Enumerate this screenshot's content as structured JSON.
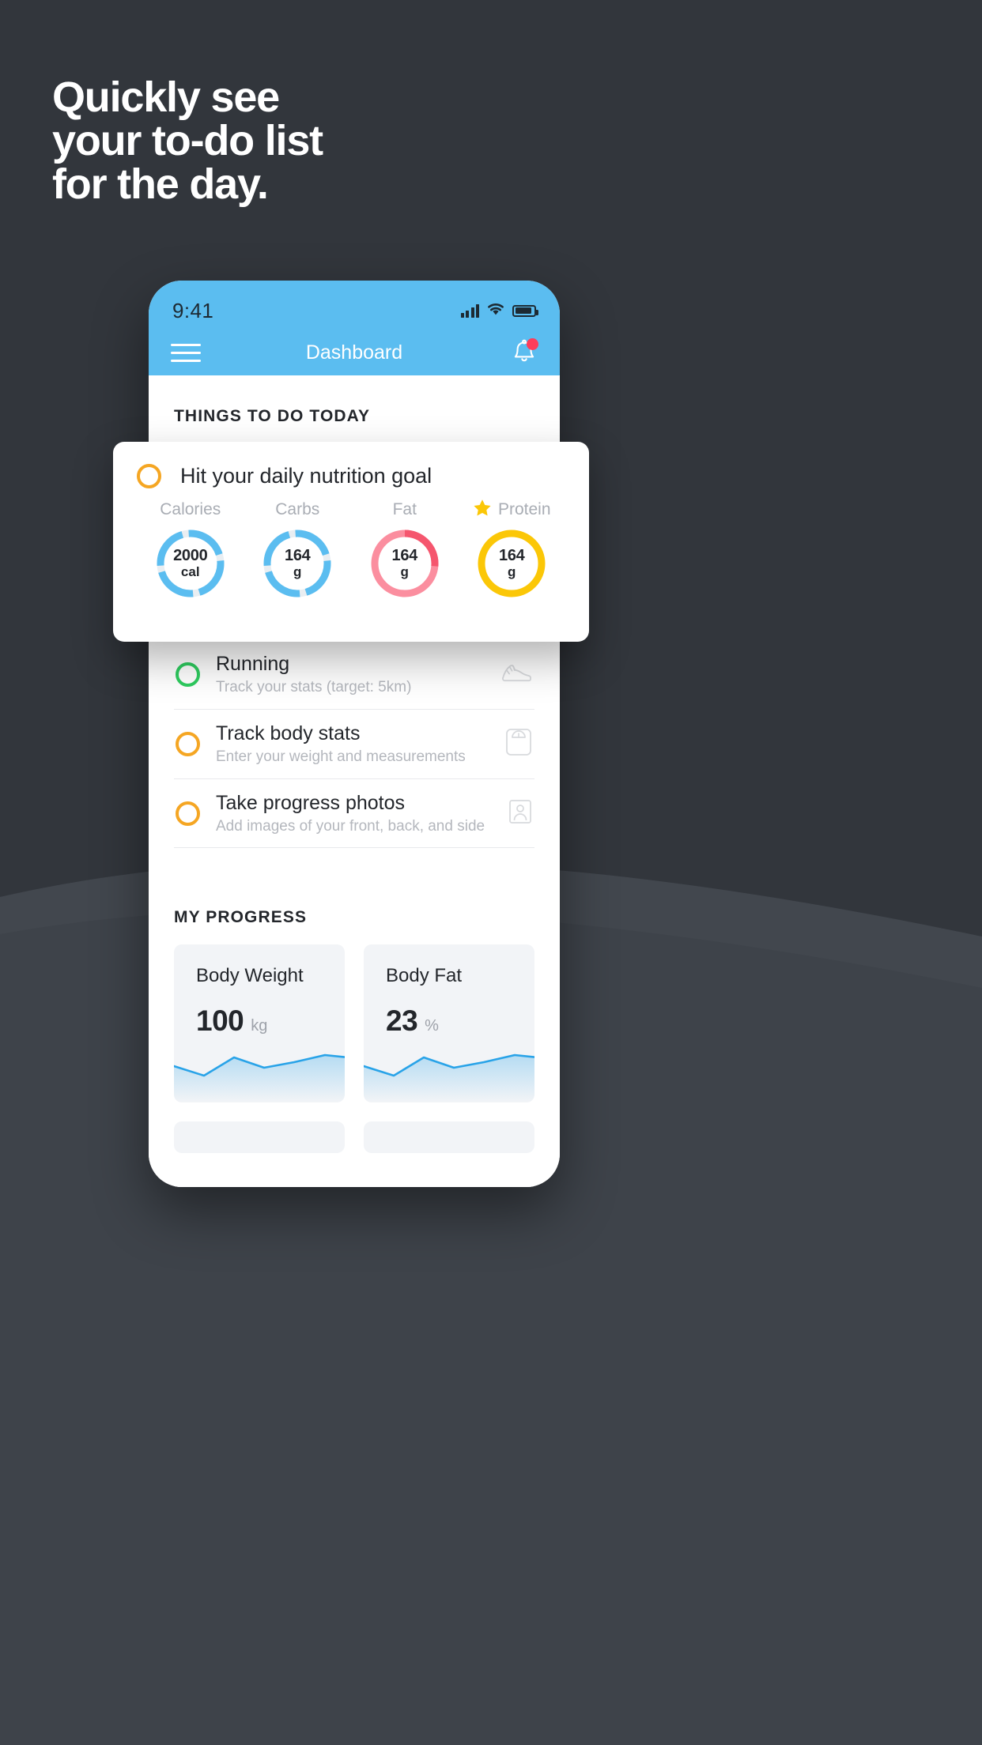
{
  "headline": {
    "line1": "Quickly see",
    "line2": "your to-do list",
    "line3": "for the day."
  },
  "colors": {
    "background": "#32363c",
    "brand_blue": "#5bbdf0",
    "accent_yellow": "#f5a623",
    "accent_gold": "#fbc707",
    "accent_green": "#2ecc5f",
    "accent_red": "#f5566e",
    "accent_pink": "#fb8e9f",
    "notification_red": "#fc3d5a",
    "card_bg": "#f2f4f7",
    "text_dark": "#23262b",
    "text_muted": "#b4b7bd"
  },
  "phone": {
    "status_bar": {
      "time": "9:41",
      "signal_icon": "cellular-signal-icon",
      "wifi_icon": "wifi-icon",
      "battery_icon": "battery-icon"
    },
    "nav": {
      "menu_icon": "hamburger-menu-icon",
      "title": "Dashboard",
      "bell_icon": "notification-bell-icon",
      "has_notification": true
    },
    "todo_section": {
      "title": "THINGS TO DO TODAY",
      "tasks": [
        {
          "title": "Running",
          "subtitle": "Track your stats (target: 5km)",
          "check_color": "#2ecc5f",
          "icon": "running-shoe-icon"
        },
        {
          "title": "Track body stats",
          "subtitle": "Enter your weight and measurements",
          "check_color": "#f5a623",
          "icon": "weight-scale-icon"
        },
        {
          "title": "Take progress photos",
          "subtitle": "Add images of your front, back, and side",
          "check_color": "#f5a623",
          "icon": "person-photo-icon"
        }
      ]
    },
    "progress_section": {
      "title": "MY PROGRESS",
      "cards": [
        {
          "label": "Body Weight",
          "value": "100",
          "unit": "kg"
        },
        {
          "label": "Body Fat",
          "value": "23",
          "unit": "%"
        }
      ]
    }
  },
  "nutrition_card": {
    "check_color": "#f5a623",
    "title": "Hit your daily nutrition goal",
    "macros": [
      {
        "label": "Calories",
        "value": "2000",
        "unit": "cal",
        "ring_color": "#5bbdf0",
        "track_color": "#e9eef2",
        "starred": false,
        "segments": 4
      },
      {
        "label": "Carbs",
        "value": "164",
        "unit": "g",
        "ring_color": "#5bbdf0",
        "track_color": "#e9eef2",
        "starred": false,
        "segments": 4
      },
      {
        "label": "Fat",
        "value": "164",
        "unit": "g",
        "ring_color": "#f5566e",
        "track_color": "#fb8e9f",
        "starred": false,
        "segments": 1
      },
      {
        "label": "Protein",
        "value": "164",
        "unit": "g",
        "ring_color": "#fbc707",
        "track_color": "#fbc707",
        "starred": true,
        "segments": 0
      }
    ],
    "star_icon": "star-icon"
  },
  "chart_data": [
    {
      "type": "line",
      "title": "Body Weight",
      "ylabel": "kg",
      "values": [
        100,
        96,
        104,
        101,
        103,
        105,
        104
      ],
      "x": [
        1,
        2,
        3,
        4,
        5,
        6,
        7
      ],
      "current_value": 100,
      "unit": "kg",
      "line_color": "#29a3e8",
      "fill": true,
      "grid": false,
      "legend": "none"
    },
    {
      "type": "line",
      "title": "Body Fat",
      "ylabel": "%",
      "values": [
        100,
        96,
        104,
        101,
        103,
        105,
        104
      ],
      "x": [
        1,
        2,
        3,
        4,
        5,
        6,
        7
      ],
      "current_value": 23,
      "unit": "%",
      "line_color": "#29a3e8",
      "fill": true,
      "grid": false,
      "legend": "none"
    },
    {
      "type": "pie",
      "title": "Daily nutrition goal rings",
      "categories": [
        "Calories",
        "Carbs",
        "Fat",
        "Protein"
      ],
      "values": [
        2000,
        164,
        164,
        164
      ],
      "units": [
        "cal",
        "g",
        "g",
        "g"
      ],
      "colors": [
        "#5bbdf0",
        "#5bbdf0",
        "#f5566e",
        "#fbc707"
      ]
    }
  ]
}
